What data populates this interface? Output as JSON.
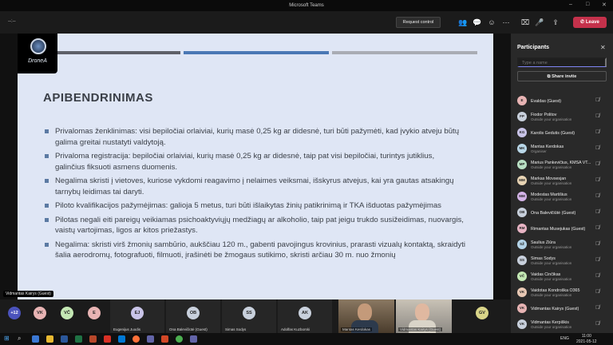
{
  "window": {
    "title": "Microsoft Teams"
  },
  "toolbar": {
    "timer": "--:--",
    "request_control": "Request control",
    "leave": "Leave"
  },
  "slide": {
    "logo_text": "DroneA",
    "heading": "APIBENDRINIMAS",
    "bullets": [
      "Privalomas ženklinimas: visi bepiločiai orlaiviai, kurių masė 0,25 kg ar didesnė, turi būti pažymėti, kad įvykio atveju būtų galima greitai nustatyti valdytoją.",
      "Privaloma registracija: bepiločiai orlaiviai, kurių masė 0,25 kg ar didesnė, taip pat visi bepiločiai, turintys jutiklius, galinčius fiksuoti asmens duomenis.",
      "Negalima skristi į vietoves, kuriose vykdomi reagavimo į nelaimes veiksmai, išskyrus atvejus, kai yra gautas atsakingų tarnybų leidimas tai daryti.",
      "Piloto kvalifikacijos pažymėjimas: galioja 5 metus, turi būti išlaikytas žinių patikrinimą ir TKA išduotas pažymėjimas",
      "Pilotas negali eiti pareigų veikiamas psichoaktyviųjų medžiagų ar alkoholio, taip pat jeigu trukdo susižeidimas, nuovargis, vaistų vartojimas, ligos ar kitos priežastys.",
      "Negalima: skristi virš žmonių sambūrio, aukščiau 120 m., gabenti pavojingus krovinius, prarasti vizualų kontaktą, skraidyti šalia aerodromų, fotografuoti, filmuoti, įrašinėti be žmogaus sutikimo, skristi arčiau 30 m. nuo žmonių"
    ],
    "presenter_label": "Vidmantas Kairys (Guest)"
  },
  "colors": {
    "bar1": "#5e6068",
    "bar2": "#4a78b5",
    "bar3": "#a9acb4",
    "leave": "#c4314b",
    "accent": "#7f85f5"
  },
  "panel": {
    "title": "Participants",
    "search_placeholder": "Type a name",
    "share_invite": "Share invite",
    "participants": [
      {
        "initials": "E",
        "name": "Evaldas (Guest)",
        "sub": "",
        "color": "#e8b4b4"
      },
      {
        "initials": "FP",
        "name": "Fiodor Politov",
        "sub": "Outside your organisation",
        "color": "#c8d0dc"
      },
      {
        "initials": "KG",
        "name": "Karolis Gedutis (Guest)",
        "sub": "",
        "color": "#c9c4e8"
      },
      {
        "initials": "MK",
        "name": "Mantas Kerdokas",
        "sub": "Organiser",
        "color": "#b9d7e8"
      },
      {
        "initials": "MP",
        "name": "Marius Pankevičius, KMSA VT...",
        "sub": "Outside your organisation",
        "color": "#b9e0c4"
      },
      {
        "initials": "MM",
        "name": "Markas Movsesjan",
        "sub": "Outside your organisation",
        "color": "#e8d4b4"
      },
      {
        "initials": "MM",
        "name": "Modestas Martišius",
        "sub": "Outside your organisation",
        "color": "#d4b4e8"
      },
      {
        "initials": "OB",
        "name": "Ona Balevičiūtė (Guest)",
        "sub": "",
        "color": "#c8d0dc"
      },
      {
        "initials": "RM",
        "name": "Rimantas Musejukas (Guest)",
        "sub": "",
        "color": "#e8b4c4"
      },
      {
        "initials": "SŽ",
        "name": "Saulius Žiūra",
        "sub": "Outside your organisation",
        "color": "#b4d4e8"
      },
      {
        "initials": "SS",
        "name": "Simas Sodys",
        "sub": "Outside your organisation",
        "color": "#c8d0dc"
      },
      {
        "initials": "VČ",
        "name": "Vaidas Činčikas",
        "sub": "Outside your organisation",
        "color": "#c4e8b4"
      },
      {
        "initials": "VK",
        "name": "Vaidotas Kondroška O365",
        "sub": "Outside your organisation",
        "color": "#e8c8b4"
      },
      {
        "initials": "VK",
        "name": "Vidmantas Kairys (Guest)",
        "sub": "",
        "color": "#e8b4b4"
      },
      {
        "initials": "VK",
        "name": "Vidmantas Kerpiškis",
        "sub": "Outside your organisation",
        "color": "#c8d0dc"
      }
    ]
  },
  "strip": {
    "more": "+12",
    "small": [
      {
        "initials": "VK",
        "color": "#e8b4b4"
      },
      {
        "initials": "VČ",
        "color": "#c4e8b4"
      },
      {
        "initials": "E",
        "color": "#e8b4b4"
      }
    ],
    "tiles": [
      {
        "initials": "EJ",
        "name": "Eugenijus Juodis",
        "color": "#c9c4e8"
      },
      {
        "initials": "OB",
        "name": "Ona Balevičiūtė (Guest)",
        "color": "#c8d0dc"
      },
      {
        "initials": "SS",
        "name": "Simas Sodys",
        "color": "#c8d0dc"
      },
      {
        "initials": "AK",
        "name": "Adolfas Kuzborski",
        "color": "#c8d0dc"
      }
    ],
    "videos": [
      {
        "name": "Mantas Kerdokas"
      },
      {
        "name": "Vidmantas Kairys (Guest)"
      }
    ],
    "last": {
      "initials": "GV",
      "color": "#d8d488"
    }
  },
  "taskbar": {
    "time": "11:00",
    "date": "2021-05-12",
    "lang": "ENG"
  }
}
